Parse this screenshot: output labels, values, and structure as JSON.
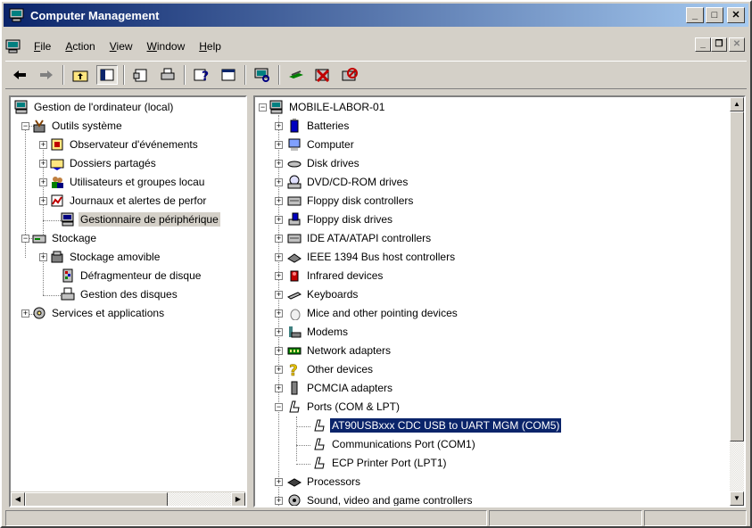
{
  "window": {
    "title": "Computer Management",
    "buttons": [
      "_",
      "□",
      "✕"
    ]
  },
  "menu": [
    {
      "key": "F",
      "rest": "ile"
    },
    {
      "key": "A",
      "rest": "ction"
    },
    {
      "key": "V",
      "rest": "iew"
    },
    {
      "key": "W",
      "rest": "indow"
    },
    {
      "key": "H",
      "rest": "elp"
    }
  ],
  "toolbar": {
    "icons": [
      "back-icon",
      "forward-icon",
      "up-folder-icon",
      "show-hide-tree-icon",
      "properties-icon",
      "print-icon",
      "help-icon",
      "console-icon",
      "scan-hardware-icon",
      "uninstall-icon",
      "disable-icon"
    ]
  },
  "left_tree": [
    {
      "label": "Gestion de l'ordinateur (local)",
      "icon": "computer-icon"
    },
    {
      "label": "Outils système",
      "icon": "tools-icon"
    },
    {
      "label": "Observateur d'événements",
      "icon": "event-viewer-icon"
    },
    {
      "label": "Dossiers partagés",
      "icon": "shared-folder-icon"
    },
    {
      "label": "Utilisateurs et groupes locau",
      "icon": "users-icon"
    },
    {
      "label": "Journaux et alertes de perfor",
      "icon": "perf-logs-icon"
    },
    {
      "label": "Gestionnaire de périphérique",
      "icon": "device-manager-icon"
    },
    {
      "label": "Stockage",
      "icon": "storage-icon"
    },
    {
      "label": "Stockage amovible",
      "icon": "removable-storage-icon"
    },
    {
      "label": "Défragmenteur de disque",
      "icon": "defrag-icon"
    },
    {
      "label": "Gestion des disques",
      "icon": "disk-management-icon"
    },
    {
      "label": "Services et applications",
      "icon": "services-icon"
    }
  ],
  "right_tree": [
    {
      "label": "MOBILE-LABOR-01",
      "icon": "computer-icon"
    },
    {
      "label": "Batteries",
      "icon": "battery-icon"
    },
    {
      "label": "Computer",
      "icon": "computer-icon"
    },
    {
      "label": "Disk drives",
      "icon": "disk-drive-icon"
    },
    {
      "label": "DVD/CD-ROM drives",
      "icon": "cdrom-icon"
    },
    {
      "label": "Floppy disk controllers",
      "icon": "controller-icon"
    },
    {
      "label": "Floppy disk drives",
      "icon": "floppy-icon"
    },
    {
      "label": "IDE ATA/ATAPI controllers",
      "icon": "controller-icon"
    },
    {
      "label": "IEEE 1394 Bus host controllers",
      "icon": "firewire-icon"
    },
    {
      "label": "Infrared devices",
      "icon": "infrared-icon"
    },
    {
      "label": "Keyboards",
      "icon": "keyboard-icon"
    },
    {
      "label": "Mice and other pointing devices",
      "icon": "mouse-icon"
    },
    {
      "label": "Modems",
      "icon": "modem-icon"
    },
    {
      "label": "Network adapters",
      "icon": "network-adapter-icon"
    },
    {
      "label": "Other devices",
      "icon": "question-icon"
    },
    {
      "label": "PCMCIA adapters",
      "icon": "pcmcia-icon"
    },
    {
      "label": "Ports (COM & LPT)",
      "icon": "port-icon"
    },
    {
      "label": "AT90USBxxx CDC USB to UART MGM (COM5)",
      "icon": "port-icon"
    },
    {
      "label": "Communications Port (COM1)",
      "icon": "port-icon"
    },
    {
      "label": "ECP Printer Port (LPT1)",
      "icon": "port-icon"
    },
    {
      "label": "Processors",
      "icon": "processor-icon"
    },
    {
      "label": "Sound, video and game controllers",
      "icon": "sound-icon"
    }
  ],
  "colors": {
    "title_gradient_start": "#0a246a",
    "title_gradient_end": "#a6caf0",
    "selection": "#0a246a",
    "face": "#d4d0c8"
  }
}
